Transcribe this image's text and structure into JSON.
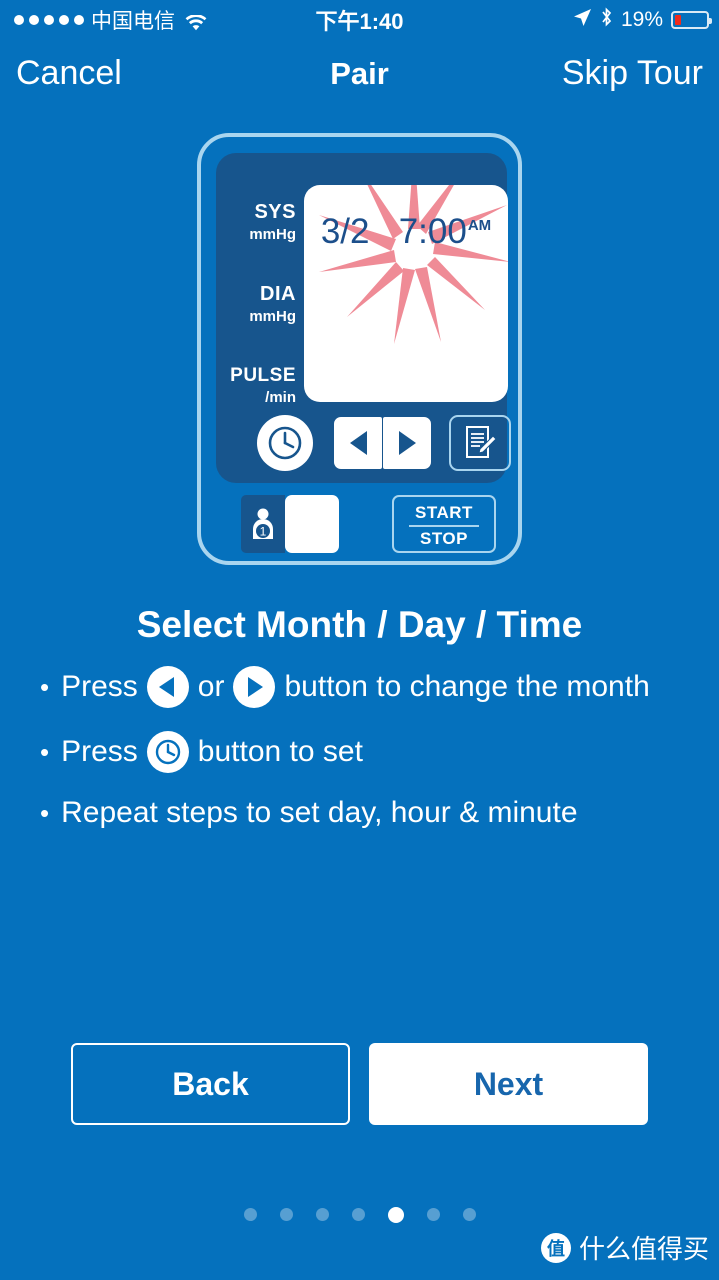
{
  "statusbar": {
    "signal_dots": 5,
    "carrier": "中国电信",
    "wifi_icon": "wifi-icon",
    "time": "下午1:40",
    "location_icon": "location-arrow-icon",
    "bluetooth_icon": "bluetooth-icon",
    "battery_percent": "19%",
    "battery_level": 19,
    "battery_color": "#f02b1d"
  },
  "navbar": {
    "cancel_label": "Cancel",
    "title": "Pair",
    "skip_label": "Skip Tour"
  },
  "device": {
    "screen": {
      "date": "3/2",
      "time": "7:00",
      "meridiem": "AM"
    },
    "measurement_labels": [
      {
        "name": "SYS",
        "unit": "mmHg"
      },
      {
        "name": "DIA",
        "unit": "mmHg"
      },
      {
        "name": "PULSE",
        "unit": "/min"
      }
    ],
    "buttons": {
      "clock_icon": "clock-icon",
      "left_arrow_icon": "left-arrow-icon",
      "right_arrow_icon": "right-arrow-icon",
      "memo_icon": "memo-document-icon",
      "user_icon": "user-1-icon",
      "user_number": "1",
      "start_label": "START",
      "stop_label": "STOP"
    },
    "colors": {
      "background": "#0571bd",
      "body": "#17558d",
      "outline": "#a9d5ef",
      "screen": "#ffffff",
      "readout_text": "#1c4f8b",
      "burst": "#ef8b96"
    }
  },
  "instructions": {
    "title": "Select Month / Day / Time",
    "bullets": [
      {
        "prefix": "Press",
        "icon_1": "left-arrow-icon",
        "middle": "or",
        "icon_2": "right-arrow-icon",
        "suffix": "button to change the month"
      },
      {
        "prefix": "Press",
        "icon_1": "clock-icon",
        "suffix": "button to set"
      },
      {
        "text": "Repeat steps to set day, hour & minute"
      }
    ]
  },
  "footer": {
    "back_label": "Back",
    "next_label": "Next"
  },
  "pager": {
    "total": 7,
    "active_index": 4
  },
  "watermark": {
    "badge": "值",
    "text": "什么值得买"
  }
}
